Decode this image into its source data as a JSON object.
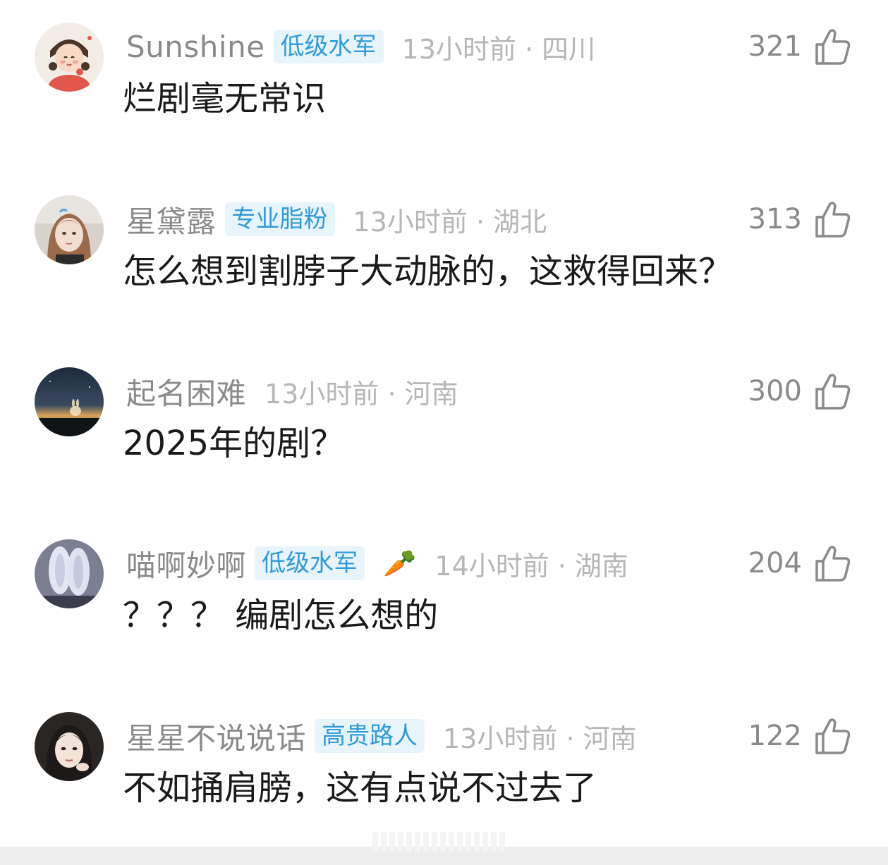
{
  "colors": {
    "username": "#8a8a8a",
    "meta": "#b6b6b6",
    "badge_bg": "#e8f4fb",
    "badge_text": "#2f9ad8",
    "content": "#1a1a1a"
  },
  "comments": [
    {
      "username": "Sunshine",
      "badge": "低级水军",
      "meta": "13小时前 · 四川",
      "likes": "321",
      "content": "烂剧毫无常识",
      "avatar_icon": "cartoon-girl-avatar"
    },
    {
      "username": "星黛露",
      "badge": "专业脂粉",
      "meta": "13小时前 · 湖北",
      "likes": "313",
      "content": "怎么想到割脖子大动脉的，这救得回来？",
      "avatar_icon": "girl-photo-avatar"
    },
    {
      "username": "起名困难",
      "meta": "13小时前 · 河南",
      "likes": "300",
      "content": "2025年的剧？",
      "avatar_icon": "night-sky-bunny-avatar"
    },
    {
      "username": "喵啊妙啊",
      "badge": "低级水军",
      "emoji": "🥕",
      "meta": "14小时前 · 湖南",
      "likes": "204",
      "content": "？？？ 编剧怎么想的",
      "avatar_icon": "plush-bunny-avatar"
    },
    {
      "username": "星星不说说话",
      "badge": "高贵路人",
      "meta": "13小时前 · 河南",
      "likes": "122",
      "content": "不如捅肩膀，这有点说不过去了",
      "avatar_icon": "woman-portrait-avatar"
    }
  ]
}
